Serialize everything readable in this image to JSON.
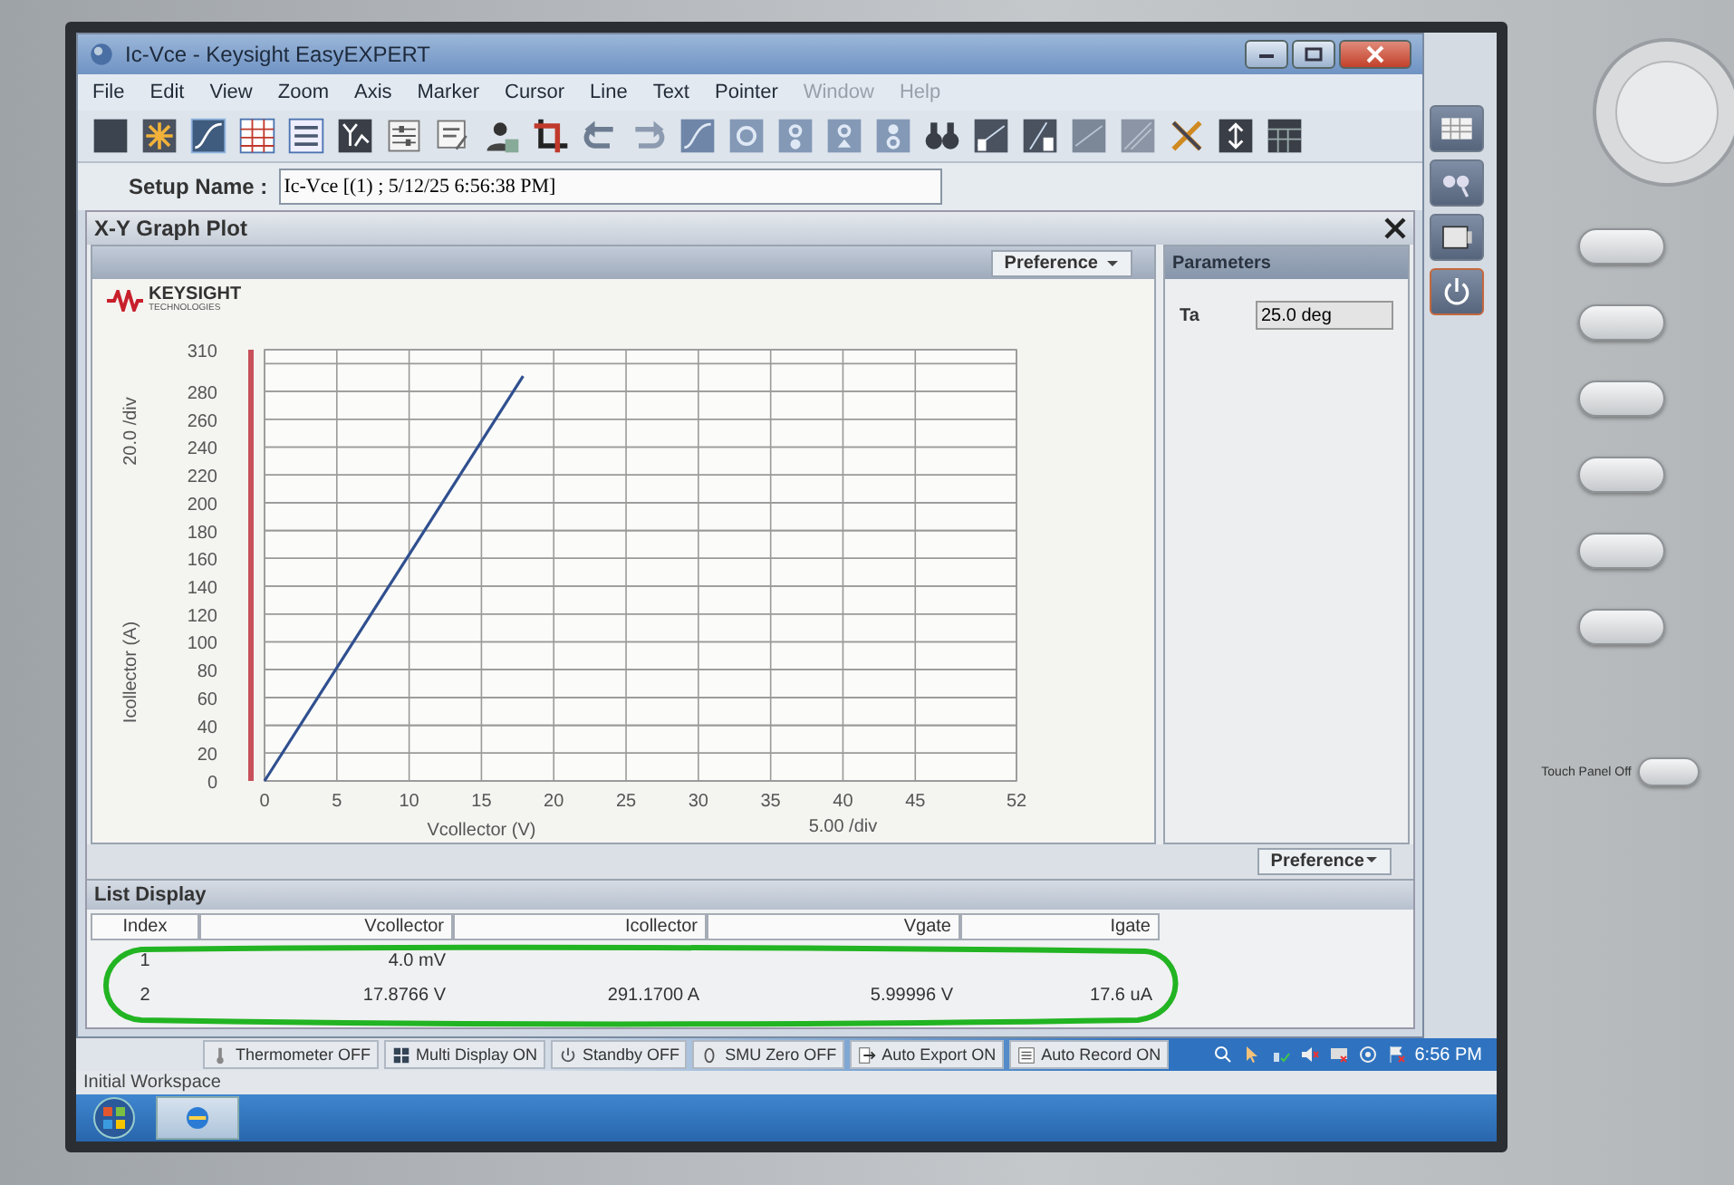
{
  "window": {
    "title": "Ic-Vce - Keysight EasyEXPERT"
  },
  "menu": [
    {
      "label": "File",
      "disabled": false
    },
    {
      "label": "Edit",
      "disabled": false
    },
    {
      "label": "View",
      "disabled": false
    },
    {
      "label": "Zoom",
      "disabled": false
    },
    {
      "label": "Axis",
      "disabled": false
    },
    {
      "label": "Marker",
      "disabled": false
    },
    {
      "label": "Cursor",
      "disabled": false
    },
    {
      "label": "Line",
      "disabled": false
    },
    {
      "label": "Text",
      "disabled": false
    },
    {
      "label": "Pointer",
      "disabled": false
    },
    {
      "label": "Window",
      "disabled": true
    },
    {
      "label": "Help",
      "disabled": true
    }
  ],
  "setup": {
    "label": "Setup Name :",
    "value": "Ic-Vce [(1) ; 5/12/25 6:56:38 PM]"
  },
  "graph_panel": {
    "title": "X-Y Graph Plot",
    "logo": "KEYSIGHT",
    "logo_sub": "TECHNOLOGIES",
    "preference": "Preference",
    "y_scale": "20.0 /div",
    "x_scale": "5.00 /div",
    "bottom_preference": "Preference",
    "chart_data": {
      "type": "line",
      "xlabel": "Vcollector (V)",
      "ylabel": "Icollector (A)",
      "x": [
        0.004,
        17.8766
      ],
      "series": [
        {
          "color": "#2f4f8f",
          "values": [
            0,
            291
          ]
        }
      ],
      "grid": true,
      "xlim": [
        0,
        52
      ],
      "ylim": [
        0,
        310
      ],
      "xticks": [
        0,
        5,
        10,
        15,
        20,
        25,
        30,
        35,
        40,
        45,
        52
      ],
      "yticks": [
        0,
        20,
        40,
        60,
        80,
        100,
        120,
        140,
        160,
        180,
        200,
        220,
        240,
        260,
        280,
        310
      ]
    }
  },
  "parameters": {
    "title": "Parameters",
    "rows": [
      {
        "name": "Ta",
        "value": "25.0 deg"
      }
    ]
  },
  "list_display": {
    "title": "List Display",
    "columns": [
      "Index",
      "Vcollector",
      "Icollector",
      "Vgate",
      "Igate"
    ],
    "rows": [
      {
        "cells": [
          "1",
          "4.0 mV",
          null,
          null,
          null
        ]
      },
      {
        "cells": [
          "2",
          "17.8766 V",
          "291.1700 A",
          "5.99996 V",
          "17.6 uA"
        ]
      }
    ]
  },
  "status_items": [
    {
      "kind": "thermometer",
      "label": "Thermometer OFF"
    },
    {
      "kind": "multi_display",
      "label": "Multi Display ON"
    },
    {
      "kind": "standby",
      "label": "Standby OFF"
    },
    {
      "kind": "smu_zero",
      "label": "SMU Zero OFF"
    },
    {
      "kind": "auto_export",
      "label": "Auto Export ON"
    },
    {
      "kind": "auto_record",
      "label": "Auto Record ON"
    }
  ],
  "taskbar": {
    "workspace": "Initial Workspace",
    "clock": "6:56 PM"
  },
  "bezel": {
    "touch_panel": "Touch Panel Off"
  }
}
